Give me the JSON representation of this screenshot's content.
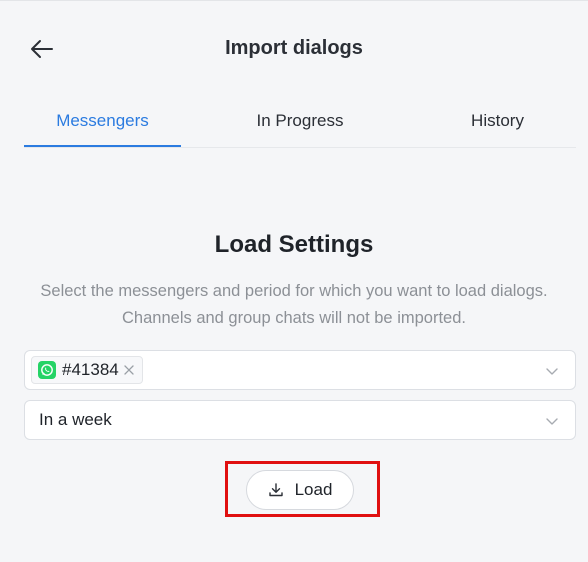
{
  "header": {
    "title": "Import dialogs",
    "back_icon": "arrow-left-icon"
  },
  "tabs": [
    {
      "label": "Messengers",
      "active": true
    },
    {
      "label": "In Progress",
      "active": false
    },
    {
      "label": "History",
      "active": false
    }
  ],
  "load_settings": {
    "title": "Load Settings",
    "description_line1": "Select the messengers and period for which you want to load dialogs.",
    "description_line2": "Channels and group chats will not be imported.",
    "messengers_select": {
      "selected_tag": "#41384",
      "tag_icon": "whatsapp-icon"
    },
    "period_select": {
      "value": "In a week"
    },
    "load_button": {
      "label": "Load",
      "icon": "download-icon"
    }
  },
  "colors": {
    "accent": "#2b7be0",
    "highlight": "#e01010",
    "whatsapp": "#25d366",
    "background": "#f5f6f8"
  }
}
